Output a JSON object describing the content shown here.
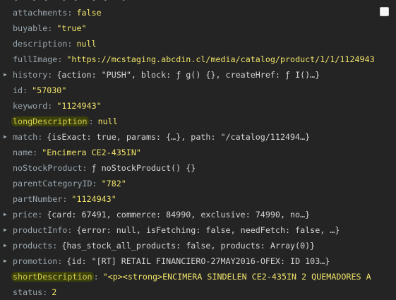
{
  "header_cut": "{...} {...} {...} {...}",
  "properties": [
    {
      "key": "attachments",
      "value": "false",
      "type": "kw",
      "expandable": false,
      "highlight": false
    },
    {
      "key": "buyable",
      "value": "\"true\"",
      "type": "str",
      "expandable": false,
      "highlight": false
    },
    {
      "key": "description",
      "value": "null",
      "type": "kw",
      "expandable": false,
      "highlight": false
    },
    {
      "key": "fullImage",
      "value": "\"https://mcstaging.abcdin.cl/media/catalog/product/1/1/1124943",
      "type": "str",
      "expandable": false,
      "highlight": false
    },
    {
      "key": "history",
      "value": "{action: \"PUSH\", block: ƒ g() {}, createHref: ƒ I()…}",
      "type": "obj",
      "expandable": true,
      "highlight": false
    },
    {
      "key": "id",
      "value": "\"57030\"",
      "type": "str",
      "expandable": false,
      "highlight": false
    },
    {
      "key": "keyword",
      "value": "\"1124943\"",
      "type": "str",
      "expandable": false,
      "highlight": false
    },
    {
      "key": "longDescription",
      "value": "null",
      "type": "kw",
      "expandable": false,
      "highlight": true
    },
    {
      "key": "match",
      "value": "{isExact: true, params: {…}, path: \"/catalog/112494…}",
      "type": "obj",
      "expandable": true,
      "highlight": false
    },
    {
      "key": "name",
      "value": "\"Encimera  CE2-435IN\"",
      "type": "str",
      "expandable": false,
      "highlight": false
    },
    {
      "key": "noStockProduct",
      "value": "ƒ noStockProduct() {}",
      "type": "fn",
      "expandable": false,
      "highlight": false
    },
    {
      "key": "parentCategoryID",
      "value": "\"782\"",
      "type": "str",
      "expandable": false,
      "highlight": false
    },
    {
      "key": "partNumber",
      "value": "\"1124943\"",
      "type": "str",
      "expandable": false,
      "highlight": false
    },
    {
      "key": "price",
      "value": "{card: 67491, commerce: 84990, exclusive: 74990, no…}",
      "type": "obj",
      "expandable": true,
      "highlight": false
    },
    {
      "key": "productInfo",
      "value": "{error: null, isFetching: false, needFetch: false, …}",
      "type": "obj",
      "expandable": true,
      "highlight": false
    },
    {
      "key": "products",
      "value": "{has_stock_all_products: false, products: Array(0)}",
      "type": "obj",
      "expandable": true,
      "highlight": false
    },
    {
      "key": "promotion",
      "value": "{id: \"[RT] RETAIL FINANCIERO-27MAY2016-OFEX: ID 103…}",
      "type": "obj",
      "expandable": true,
      "highlight": false
    },
    {
      "key": "shortDescription",
      "value": "\"<p><strong>ENCIMERA SINDELEN CE2-435IN 2 QUEMADORES A",
      "type": "str",
      "expandable": false,
      "highlight": true
    },
    {
      "key": "status",
      "value": "2",
      "type": "kw",
      "expandable": false,
      "highlight": false
    }
  ],
  "colors": {
    "background": "#242424",
    "key": "#9aa6ae",
    "string_value": "#f2e46a",
    "highlight_bg": "#4a5200"
  },
  "icons": {
    "expand": "triangle-right-icon",
    "checkbox": "checkbox-icon"
  }
}
